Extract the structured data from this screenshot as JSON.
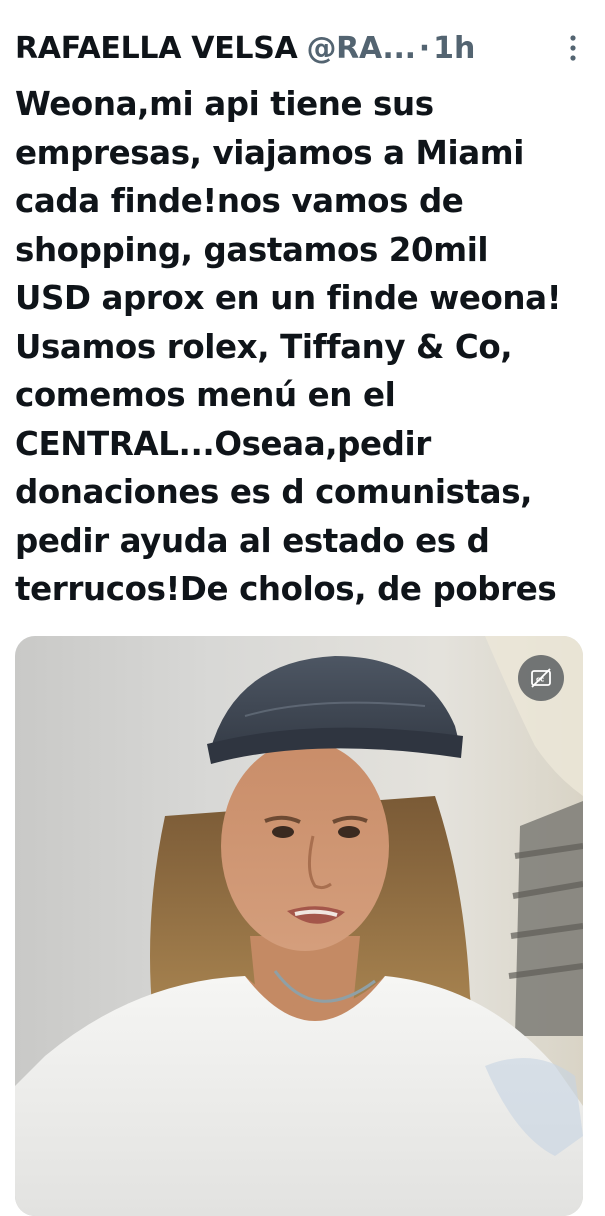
{
  "tweet": {
    "author_name": "RAFAELLA VELSA",
    "author_handle": "@RA...",
    "separator": "·",
    "timestamp": "1h",
    "text_lines": [
      "Weona,mi api tiene sus",
      "empresas, viajamos a Miami",
      "cada finde!nos vamos de",
      "shopping, gastamos 20mil",
      "USD aprox en un finde weona!",
      "Usamos rolex, Tiffany & Co,",
      "comemos menú en el",
      "CENTRAL...Oseaa,pedir",
      "donaciones es d comunistas,",
      "pedir ayuda al estado es d",
      "terrucos!De cholos, de pobres"
    ]
  },
  "icons": {
    "more": "more-dots-icon",
    "captions": "captions-off-icon"
  },
  "colors": {
    "text_primary": "#0f1419",
    "text_secondary": "#536471"
  }
}
